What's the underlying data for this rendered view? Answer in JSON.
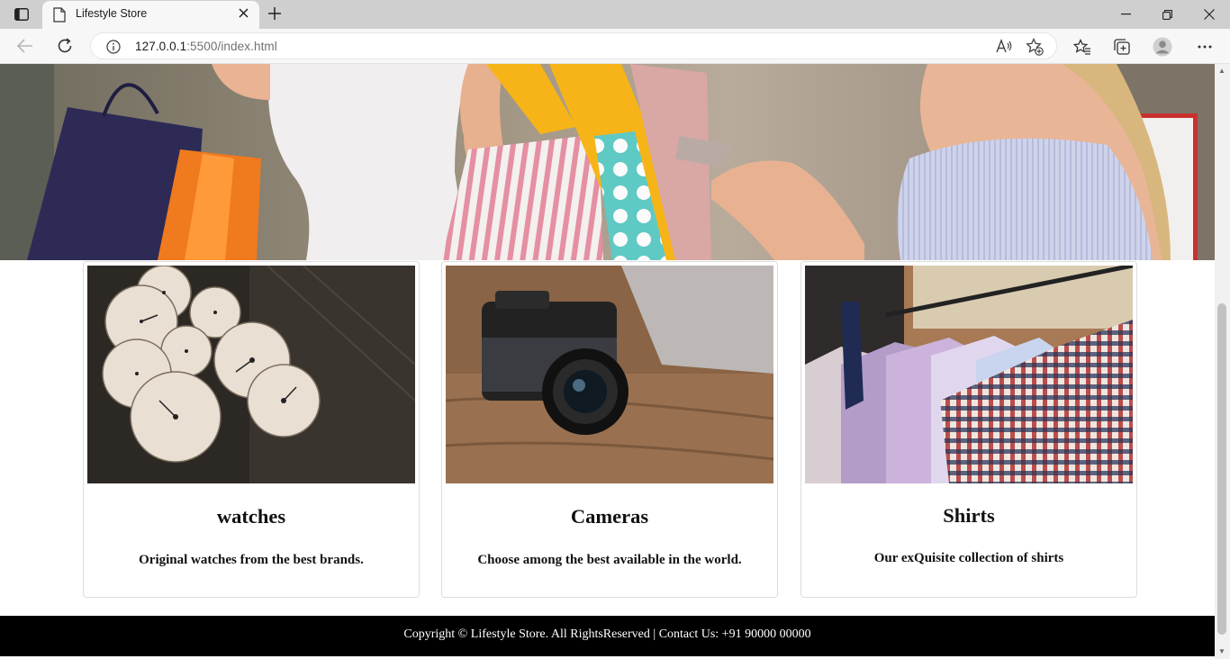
{
  "browser": {
    "tab_title": "Lifestyle Store",
    "url_host": "127.0.0.1",
    "url_rest": ":5500/index.html"
  },
  "cards": [
    {
      "title": "watches",
      "description": "Original watches from the best brands."
    },
    {
      "title": "Cameras",
      "description": "Choose among the best available in the world."
    },
    {
      "title": "Shirts",
      "description": "Our exQuisite collection of shirts"
    }
  ],
  "footer": {
    "text": "Copyright © Lifestyle Store. All RightsReserved | Contact Us: +91 90000 00000"
  },
  "icons": {
    "tab_sidebar": "tab-sidebar-icon",
    "page": "page-icon",
    "close": "close-icon",
    "new_tab": "plus-icon",
    "back": "back-arrow-icon",
    "reload": "reload-icon",
    "info": "info-icon",
    "read_aloud": "read-aloud-icon",
    "add_favorite": "star-plus-icon",
    "favorites": "favorites-icon",
    "collections": "collections-icon",
    "profile": "profile-icon",
    "menu": "more-icon"
  },
  "colors": {
    "tabbar": "#cfcfcf",
    "toolbar": "#f7f7f7",
    "footer_bg": "#000000",
    "footer_text": "#ffffff",
    "card_border": "#dddddd"
  }
}
